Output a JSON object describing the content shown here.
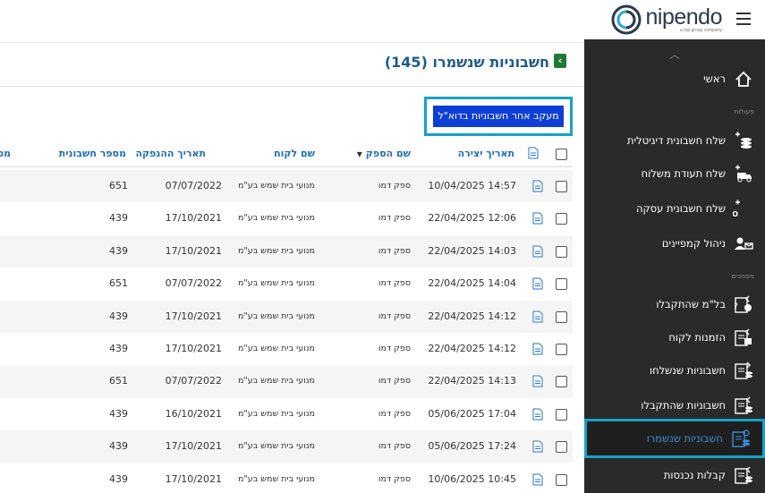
{
  "brand": {
    "name": "nipendo",
    "tagline": "a top group company"
  },
  "colors": {
    "sidebar_bg": "#2a2a2a",
    "accent": "#17a2c7",
    "title": "#1e5a8c",
    "button": "#0d3fd6",
    "header_text": "#1e6fb8"
  },
  "sidebar": {
    "items": [
      {
        "label": "ראשי",
        "icon": "home-icon"
      },
      {
        "label": "שלח חשבונית דיגיטלית",
        "icon": "send-invoice-icon"
      },
      {
        "label": "שלח תעודת משלוח",
        "icon": "truck-icon"
      },
      {
        "label": "שלח חשבונית עסקה",
        "icon": "pro-icon"
      },
      {
        "label": "ניהול קמפיינים",
        "icon": "campaign-icon"
      },
      {
        "label": "בל\"מ שהתקבלו",
        "icon": "received-dollar-icon"
      },
      {
        "label": "הזמנות לקוח",
        "icon": "customer-orders-icon"
      },
      {
        "label": "חשבוניות שנשלחו",
        "icon": "sent-invoices-icon"
      },
      {
        "label": "חשבוניות שהתקבלו",
        "icon": "received-invoices-icon"
      },
      {
        "label": "חשבוניות שנשמרו",
        "icon": "saved-invoices-icon"
      },
      {
        "label": "קבלות נכנסות",
        "icon": "incoming-receipts-icon"
      }
    ],
    "sections": {
      "actions": "פעולות",
      "documents": "מסמכים"
    }
  },
  "page": {
    "title": "חשבוניות שנשמרו (145)",
    "track_button": "מעקב אחר חשבוניות בדוא\"ל"
  },
  "table": {
    "headers": {
      "created": "תאריך יצירה",
      "supplier": "שם הספק",
      "customer": "שם לקוח",
      "issue_date": "תאריך ההנפקה",
      "invoice_no": "מספר חשבונית",
      "more": "מספ"
    },
    "rows": [
      {
        "created": "14:57 10/04/2025",
        "supplier": "ספק דמו",
        "customer": "מנועי בית שמש בע\"מ",
        "issue_date": "07/07/2022",
        "invoice_no": "651"
      },
      {
        "created": "12:06 22/04/2025",
        "supplier": "ספק דמו",
        "customer": "מנועי בית שמש בע\"מ",
        "issue_date": "17/10/2021",
        "invoice_no": "439"
      },
      {
        "created": "14:03 22/04/2025",
        "supplier": "ספק דמו",
        "customer": "מנועי בית שמש בע\"מ",
        "issue_date": "17/10/2021",
        "invoice_no": "439"
      },
      {
        "created": "14:04 22/04/2025",
        "supplier": "ספק דמו",
        "customer": "מנועי בית שמש בע\"מ",
        "issue_date": "07/07/2022",
        "invoice_no": "651"
      },
      {
        "created": "14:12 22/04/2025",
        "supplier": "ספק דמו",
        "customer": "מנועי בית שמש בע\"מ",
        "issue_date": "17/10/2021",
        "invoice_no": "439"
      },
      {
        "created": "14:12 22/04/2025",
        "supplier": "ספק דמו",
        "customer": "מנועי בית שמש בע\"מ",
        "issue_date": "17/10/2021",
        "invoice_no": "439"
      },
      {
        "created": "14:13 22/04/2025",
        "supplier": "ספק דמו",
        "customer": "מנועי בית שמש בע\"מ",
        "issue_date": "07/07/2022",
        "invoice_no": "651"
      },
      {
        "created": "17:04 05/06/2025",
        "supplier": "ספק דמו",
        "customer": "מנועי בית שמש בע\"מ",
        "issue_date": "16/10/2021",
        "invoice_no": "439"
      },
      {
        "created": "17:24 05/06/2025",
        "supplier": "ספק דמו",
        "customer": "מנועי בית שמש בע\"מ",
        "issue_date": "17/10/2021",
        "invoice_no": "439"
      },
      {
        "created": "10:45 10/06/2025",
        "supplier": "ספק דמו",
        "customer": "מנועי בית שמש בע\"מ",
        "issue_date": "17/10/2021",
        "invoice_no": "439"
      }
    ]
  }
}
